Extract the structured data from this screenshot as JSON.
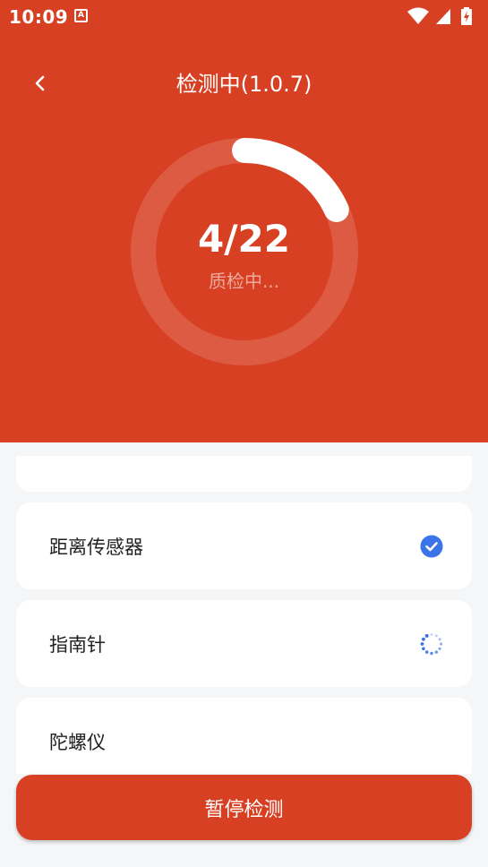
{
  "status_bar": {
    "time": "10:09",
    "notification_icon": "a-notification-icon",
    "icons": [
      "wifi-icon",
      "signal-icon",
      "battery-charging-icon"
    ]
  },
  "header": {
    "back_icon": "chevron-left-icon",
    "title": "检测中(1.0.7)"
  },
  "progress": {
    "count_text": "4/22",
    "current": 4,
    "total": 22,
    "status_text": "质检中..."
  },
  "items": [
    {
      "label": "距离传感器",
      "status": "passed",
      "status_icon": "check-circle-icon"
    },
    {
      "label": "指南针",
      "status": "testing",
      "status_icon": "spinner-icon"
    },
    {
      "label": "陀螺仪",
      "status": "pending",
      "status_icon": ""
    }
  ],
  "footer": {
    "pause_label": "暂停检测"
  },
  "colors": {
    "primary": "#d84024",
    "background": "#f4f6f8",
    "card": "#ffffff",
    "accent_blue": "#3b73e8"
  }
}
